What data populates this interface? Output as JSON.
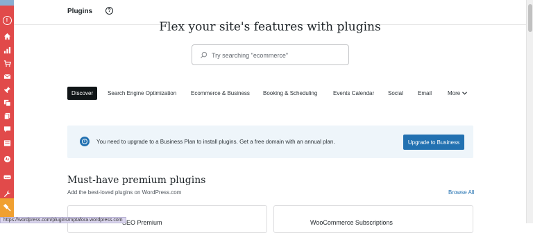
{
  "header": {
    "title": "Plugins",
    "help_icon": "help-circle-icon"
  },
  "sidebar": {
    "icons": [
      "info-icon",
      "home-icon",
      "stats-icon",
      "cart-icon",
      "mail-icon",
      "pin-icon",
      "media-icon",
      "pages-icon",
      "comments-icon",
      "feedback-icon",
      "jetpack-icon",
      "woo-icon",
      "tools-icon",
      "plugins-icon"
    ],
    "accent": "#e14a4a",
    "active_color": "#f0a030"
  },
  "hero": {
    "title": "Flex your site's features with plugins"
  },
  "search": {
    "placeholder": "Try searching \"ecommerce\""
  },
  "tabs": [
    {
      "label": "Discover",
      "active": true
    },
    {
      "label": "Search Engine Optimization"
    },
    {
      "label": "Ecommerce & Business"
    },
    {
      "label": "Booking & Scheduling"
    },
    {
      "label": "Events Calendar"
    },
    {
      "label": "Social"
    },
    {
      "label": "Email"
    },
    {
      "label": "More"
    }
  ],
  "notice": {
    "text": "You need to upgrade to a Business Plan to install plugins. Get a free domain with an annual plan.",
    "button": "Upgrade to Business",
    "accent": "#2271b1"
  },
  "section": {
    "title": "Must-have premium plugins",
    "subtitle": "Add the best-loved plugins on WordPress.com",
    "browse_all": "Browse All"
  },
  "cards": [
    {
      "title": "SEO Premium"
    },
    {
      "title": "WooCommerce Subscriptions"
    }
  ],
  "statusbar": {
    "url": "https://wordpress.com/plugins/mptafora.wordpress.com"
  }
}
